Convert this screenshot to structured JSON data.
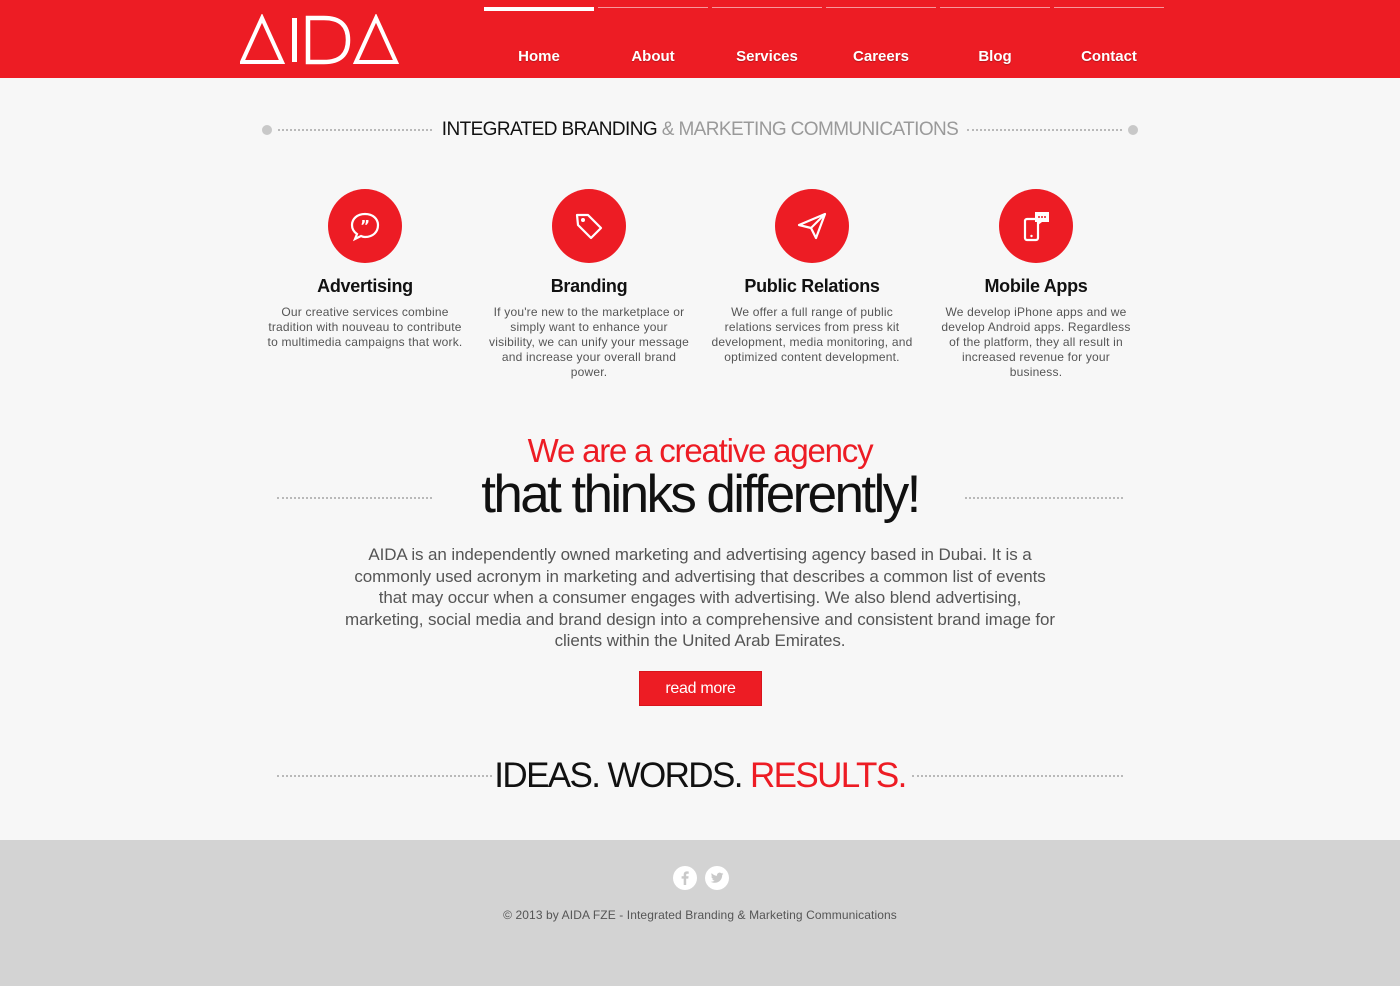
{
  "brand": {
    "logo_text": "AIDA",
    "accent_color": "#ed1c24"
  },
  "nav": {
    "items": [
      {
        "label": "Home",
        "active": true
      },
      {
        "label": "About",
        "active": false
      },
      {
        "label": "Services",
        "active": false
      },
      {
        "label": "Careers",
        "active": false
      },
      {
        "label": "Blog",
        "active": false
      },
      {
        "label": "Contact",
        "active": false
      }
    ]
  },
  "tagline": {
    "part1": "INTEGRATED BRANDING",
    "part2": " & MARKETING COMMUNICATIONS"
  },
  "services": [
    {
      "icon": "speech-bubble-quote-icon",
      "title": "Advertising",
      "desc": "Our creative services combine tradition with nouveau to contribute to multimedia campaigns that work."
    },
    {
      "icon": "price-tag-icon",
      "title": "Branding",
      "desc": "If you're new to the marketplace or simply want to enhance your visibility, we can unify your message and increase your overall brand power."
    },
    {
      "icon": "paper-plane-icon",
      "title": "Public Relations",
      "desc": "We offer a full range of public relations services from press kit development, media monitoring, and optimized content development."
    },
    {
      "icon": "mobile-chat-icon",
      "title": "Mobile Apps",
      "desc": "We develop iPhone apps and we develop Android apps. Regardless of the platform, they all result in increased revenue for your business."
    }
  ],
  "agency": {
    "headline_red": "We are a creative agency",
    "headline_black": "that thinks differently!",
    "body": "AIDA is an independently owned marketing and advertising agency based in Dubai. It is a commonly used acronym in marketing and advertising that describes a common list of events that may occur when a consumer engages with advertising. We also blend advertising, marketing, social media and brand design into a comprehensive and consistent brand image for clients within the United Arab Emirates.",
    "button_label": "read more"
  },
  "ideas": {
    "part_black": "IDEAS. WORDS. ",
    "part_red": "RESULTS."
  },
  "footer": {
    "social": [
      "facebook-icon",
      "twitter-icon"
    ],
    "copyright": "© 2013 by AIDA FZE - Integrated Branding & Marketing Communications"
  }
}
